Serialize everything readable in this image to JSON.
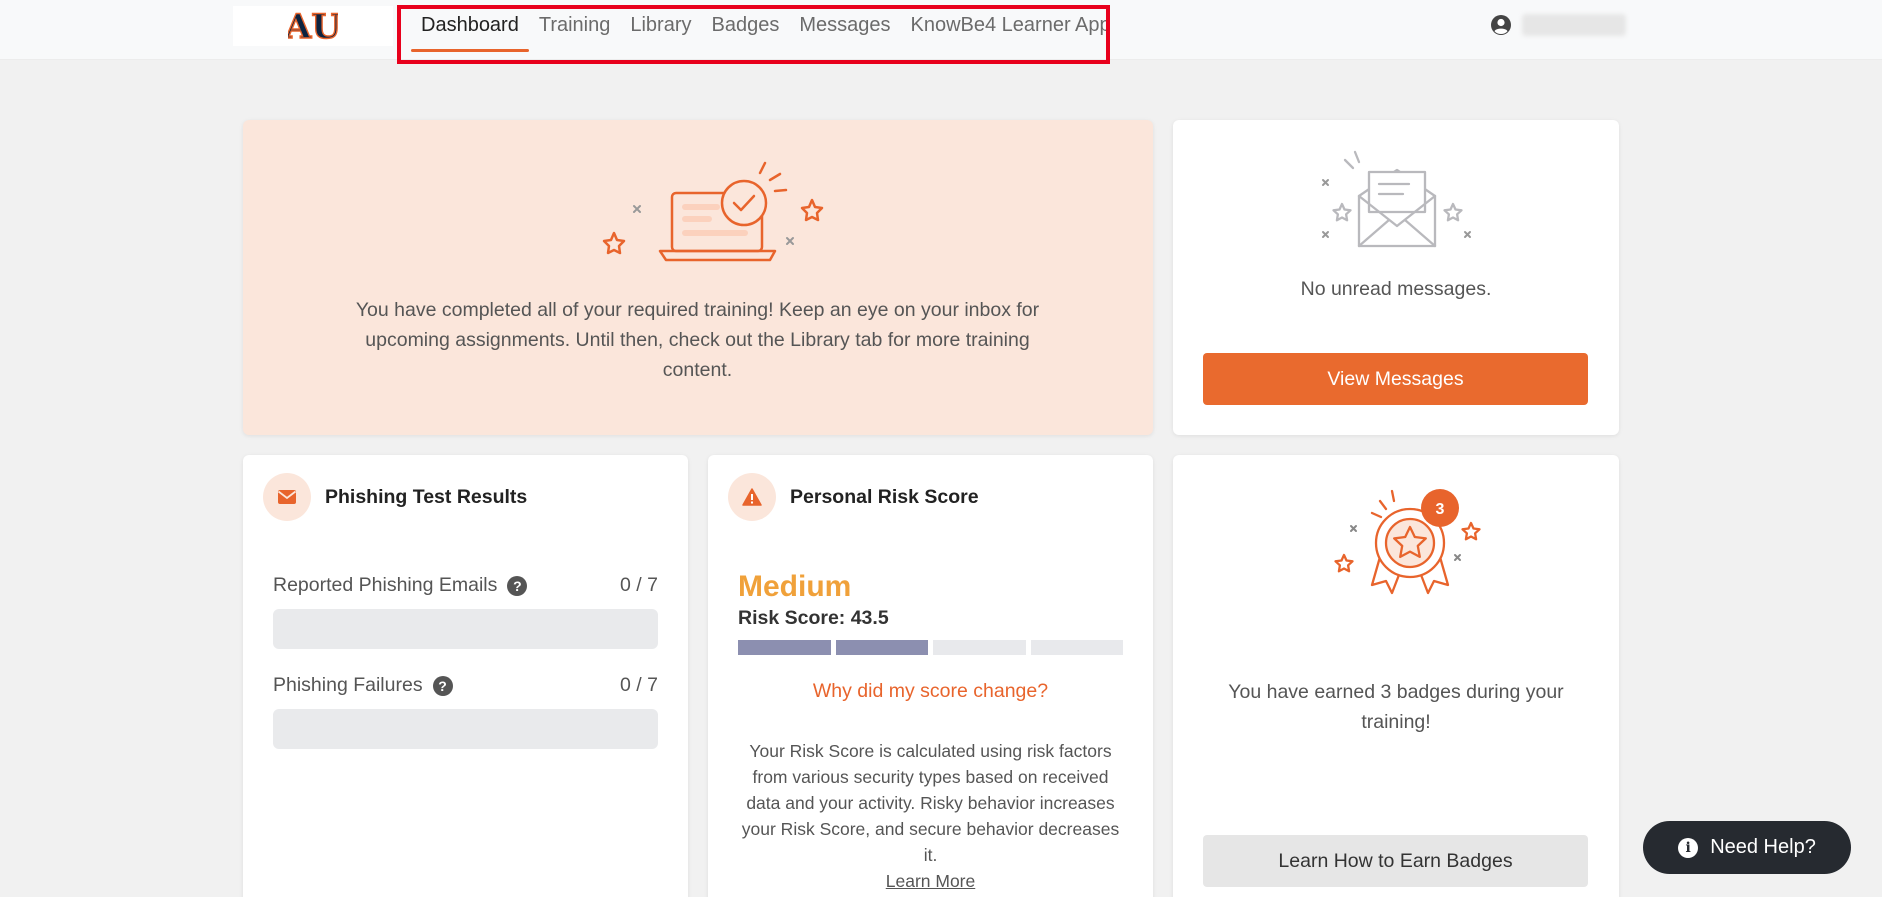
{
  "brand": {
    "logo_text": "AU",
    "accent_color": "#e96a2e",
    "navy": "#0c2340"
  },
  "nav": {
    "items": [
      {
        "label": "Dashboard",
        "active": true
      },
      {
        "label": "Training"
      },
      {
        "label": "Library"
      },
      {
        "label": "Badges"
      },
      {
        "label": "Messages"
      },
      {
        "label": "KnowBe4 Learner App"
      }
    ]
  },
  "hero": {
    "message": "You have completed all of your required training! Keep an eye on your inbox for upcoming assignments. Until then, check out the Library tab for more training content."
  },
  "messages_card": {
    "text": "No unread messages.",
    "button": "View Messages"
  },
  "phishing": {
    "title": "Phishing Test Results",
    "rows": [
      {
        "label": "Reported Phishing Emails",
        "value": "0 / 7",
        "progress": 0
      },
      {
        "label": "Phishing Failures",
        "value": "0 / 7",
        "progress": 0
      }
    ],
    "help_glyph": "?"
  },
  "risk": {
    "title": "Personal Risk Score",
    "level": "Medium",
    "score_text": "Risk Score: 43.5",
    "segments_filled": 2,
    "segments_total": 4,
    "link": "Why did my score change?",
    "description": "Your Risk Score is calculated using risk factors from various security types based on received data and your activity. Risky behavior increases your Risk Score, and secure behavior decreases it.",
    "learn_more": "Learn More"
  },
  "badges": {
    "count": "3",
    "text": "You have earned 3 badges during your training!",
    "button": "Learn How to Earn Badges"
  },
  "help": {
    "label": "Need Help?",
    "icon_glyph": "i"
  }
}
